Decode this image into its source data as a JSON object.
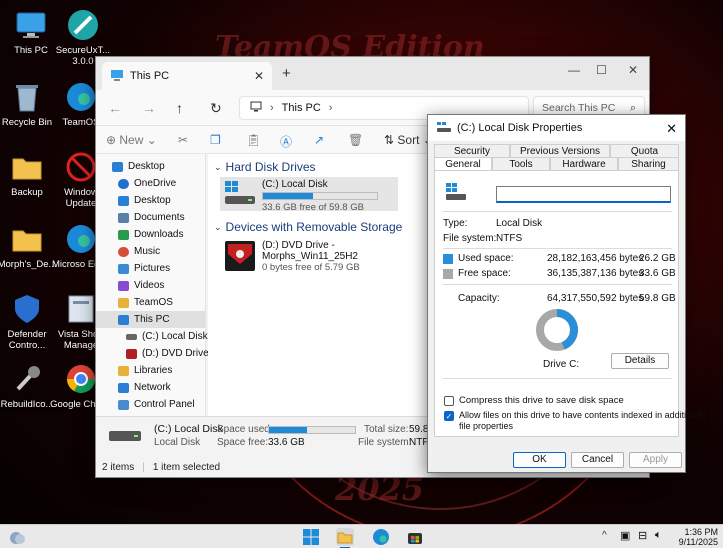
{
  "wallpaper": {
    "title": "TeamOS Edition",
    "year": "2025"
  },
  "desktop_icons": [
    {
      "label": "This PC"
    },
    {
      "label": "SecureUxT... 3.0.0"
    },
    {
      "label": "Recycle Bin"
    },
    {
      "label": "TeamOS"
    },
    {
      "label": "Backup"
    },
    {
      "label": "Window Update"
    },
    {
      "label": "Morph's_De..."
    },
    {
      "label": "Microso Edge"
    },
    {
      "label": "Defender Contro..."
    },
    {
      "label": "Vista Short Manage"
    },
    {
      "label": "RebuildIco..."
    },
    {
      "label": "Google Chrom"
    }
  ],
  "explorer": {
    "tab_title": "This PC",
    "address": "This PC",
    "search_placeholder": "Search This PC",
    "toolbar": {
      "new_label": "New",
      "sort_label": "Sort"
    },
    "nav_items": [
      {
        "label": "Desktop",
        "color": "#2a7fd4"
      },
      {
        "label": "OneDrive",
        "color": "#1f6fd0"
      },
      {
        "label": "Desktop",
        "color": "#2a7fd4"
      },
      {
        "label": "Documents",
        "color": "#5a7fa8"
      },
      {
        "label": "Downloads",
        "color": "#2a9a4a"
      },
      {
        "label": "Music",
        "color": "#d2503a"
      },
      {
        "label": "Pictures",
        "color": "#3a8ad6"
      },
      {
        "label": "Videos",
        "color": "#8a4ad0"
      },
      {
        "label": "TeamOS",
        "color": "#e8b23a"
      },
      {
        "label": "This PC",
        "color": "#2a7fd4"
      },
      {
        "label": "(C:) Local Disk",
        "color": "#666"
      },
      {
        "label": "(D:) DVD Drive",
        "color": "#b02020"
      },
      {
        "label": "Libraries",
        "color": "#e8b23a"
      },
      {
        "label": "Network",
        "color": "#2a7fd4"
      },
      {
        "label": "Control Panel",
        "color": "#4a8ad0"
      }
    ],
    "groups": {
      "hdd": "Hard Disk Drives",
      "removable": "Devices with Removable Storage"
    },
    "c_drive": {
      "name": "(C:) Local Disk",
      "free_text": "33.6 GB free of 59.8 GB",
      "used_fraction": 0.44
    },
    "d_drive": {
      "name_line1": "(D:) DVD Drive -",
      "name_line2": "Morphs_Win11_25H2",
      "free_text": "0 bytes free of 5.79 GB"
    },
    "details": {
      "name": "(C:) Local Disk",
      "type": "Local Disk",
      "space_used_label": "Space used:",
      "space_free_label": "Space free:",
      "space_free_value": "33.6 GB",
      "total_size_label": "Total size:",
      "total_size_value": "59.8",
      "file_system_label": "File system:",
      "file_system_value": "NTFS"
    },
    "status": {
      "items": "2 items",
      "selected": "1 item selected"
    }
  },
  "dialog": {
    "title": "(C:) Local Disk Properties",
    "tabs_row1": [
      "Security",
      "Previous Versions",
      "Quota"
    ],
    "tabs_row2": [
      "General",
      "Tools",
      "Hardware",
      "Sharing"
    ],
    "name_value": "",
    "type_label": "Type:",
    "type_value": "Local Disk",
    "fs_label": "File system:",
    "fs_value": "NTFS",
    "used_label": "Used space:",
    "used_bytes": "28,182,163,456 bytes",
    "used_gb": "26.2 GB",
    "free_label": "Free space:",
    "free_bytes": "36,135,387,136 bytes",
    "free_gb": "33.6 GB",
    "capacity_label": "Capacity:",
    "capacity_bytes": "64,317,550,592 bytes",
    "capacity_gb": "59.8 GB",
    "drive_label": "Drive C:",
    "details_button": "Details",
    "compress_label": "Compress this drive to save disk space",
    "compress_checked": false,
    "index_label_1": "Allow files on this drive to have contents indexed in addition to",
    "index_label_2": "file properties",
    "index_checked": true,
    "ok": "OK",
    "cancel": "Cancel",
    "apply": "Apply",
    "used_fraction": 0.44,
    "used_color": "#2a8fd6",
    "free_color": "#a8a8a8"
  },
  "taskbar": {
    "time": "1:36 PM",
    "date": "9/11/2025"
  }
}
